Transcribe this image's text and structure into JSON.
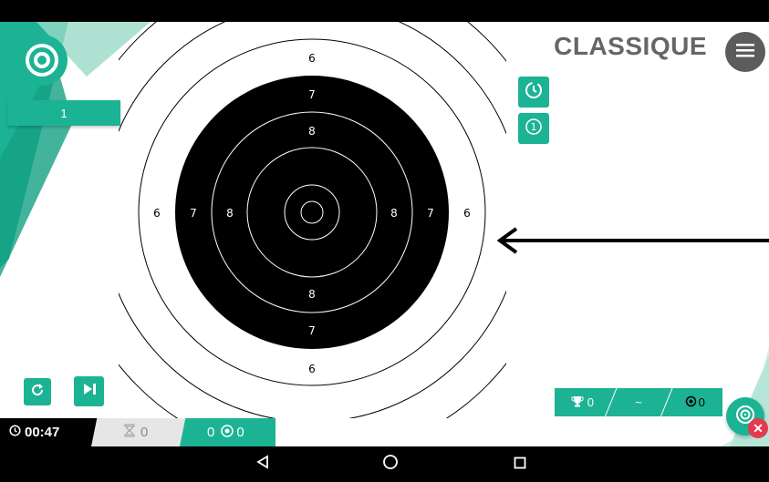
{
  "app": {
    "mode_title": "CLASSIQUE",
    "series_label": "1"
  },
  "target": {
    "ring_labels": {
      "top": [
        "6",
        "7",
        "8"
      ],
      "left": [
        "6",
        "7",
        "8"
      ],
      "right": [
        "8",
        "7",
        "6"
      ],
      "bottom": [
        "8",
        "7",
        "6"
      ]
    }
  },
  "bottom": {
    "timer": "00:47",
    "shots_count": "0",
    "score": "0"
  },
  "stats": {
    "best": "0",
    "average": "~",
    "group": "0"
  },
  "colors": {
    "accent": "#1bb394",
    "target_black": "#000000",
    "menu_grey": "#5c5c5c",
    "badge_red": "#e53950"
  },
  "icons": {
    "logo": "target-logo-icon",
    "menu": "hamburger-menu-icon",
    "timer_toggle": "timer-icon",
    "single_shot": "one-circle-icon",
    "reset": "refresh-icon",
    "next": "skip-next-icon",
    "clock": "clock-icon",
    "shots": "hourglass-icon",
    "trophy": "trophy-icon",
    "group": "grouping-icon",
    "fab": "target-add-icon",
    "fab_badge": "close-icon",
    "arrow": "arrow-left-icon",
    "nav_back": "back-triangle-icon",
    "nav_home": "home-circle-icon",
    "nav_recents": "recents-square-icon"
  }
}
